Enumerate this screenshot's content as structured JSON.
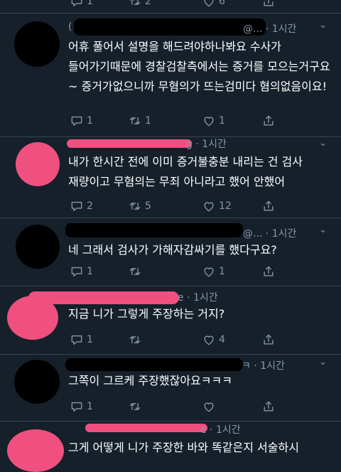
{
  "top": {
    "reply_count": "1",
    "retweet_count": "2",
    "like_count": "6"
  },
  "tweets": [
    {
      "meta": "@... · 1시간",
      "open_paren": "(",
      "body": "어휴 풀어서 설명을 해드려야하나봐요 수사가 들어가기때문에 경찰검찰측에서는 증거를 모으는거구요~ 증거가없으니까 무혐의가 뜨는검미다 혐의없음이요!",
      "reply_count": "1",
      "retweet_count": "1",
      "like_count": "1"
    },
    {
      "meta": "g · 1시간",
      "body": "내가 한시간 전에 이미 증거불충분 내리는 건 검사 재량이고 무혐의는 무죄 아니라고 했어 안했어",
      "reply_count": "2",
      "retweet_count": "5",
      "like_count": "12"
    },
    {
      "meta": "@... · 1시간",
      "body": "네 그래서 검사가 가해자감싸기를 했다구요?",
      "reply_count": "1",
      "retweet_count": "",
      "like_count": "1"
    },
    {
      "meta": "e · 1시간",
      "body": "지금 니가 그렇게 주장하는 거지?",
      "reply_count": "1",
      "retweet_count": "",
      "like_count": "4"
    },
    {
      "meta": "ㅋ · 1시간",
      "body": "그쪽이 그르케 주장했잖아요ㅋㅋㅋ",
      "reply_count": "1",
      "retweet_count": "",
      "like_count": ""
    },
    {
      "meta": "e · 1시간",
      "body": "그게 어떻게 니가 주장한 바와 똑같은지 서술하시"
    }
  ],
  "chevron": "⌄",
  "icons": {
    "reply": "reply-icon",
    "retweet": "retweet-icon",
    "like": "like-icon",
    "share": "share-icon",
    "more": "chevron-down-icon"
  }
}
